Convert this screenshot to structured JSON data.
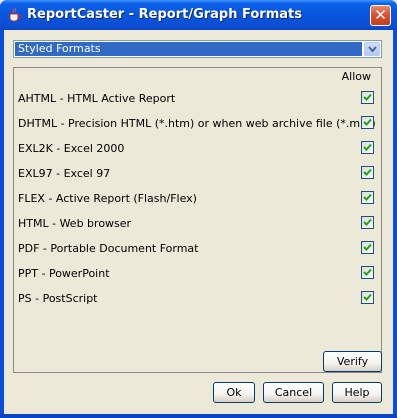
{
  "window": {
    "title": "ReportCaster - Report/Graph Formats",
    "close_glyph": "✕"
  },
  "format_set": {
    "selected": "Styled Formats"
  },
  "list": {
    "allow_header": "Allow",
    "rows": [
      {
        "label": "AHTML - HTML Active Report",
        "allowed": true
      },
      {
        "label": "DHTML - Precision HTML (*.htm) or when web archive file (*.mht)",
        "allowed": true
      },
      {
        "label": "EXL2K - Excel 2000",
        "allowed": true
      },
      {
        "label": "EXL97 - Excel 97",
        "allowed": true
      },
      {
        "label": "FLEX - Active Report (Flash/Flex)",
        "allowed": true
      },
      {
        "label": "HTML - Web browser",
        "allowed": true
      },
      {
        "label": "PDF - Portable Document Format",
        "allowed": true
      },
      {
        "label": "PPT - PowerPoint",
        "allowed": true
      },
      {
        "label": "PS - PostScript",
        "allowed": true
      }
    ]
  },
  "buttons": {
    "verify": "Verify",
    "ok": "Ok",
    "cancel": "Cancel",
    "help": "Help"
  },
  "colors": {
    "title_bar": "#0855dd",
    "selection": "#316ac5",
    "check": "#21a121",
    "close": "#d9532f"
  },
  "icons": {
    "app": "java-cup-icon",
    "close": "close-icon",
    "dropdown": "chevron-down-icon",
    "check": "checkmark-icon"
  }
}
